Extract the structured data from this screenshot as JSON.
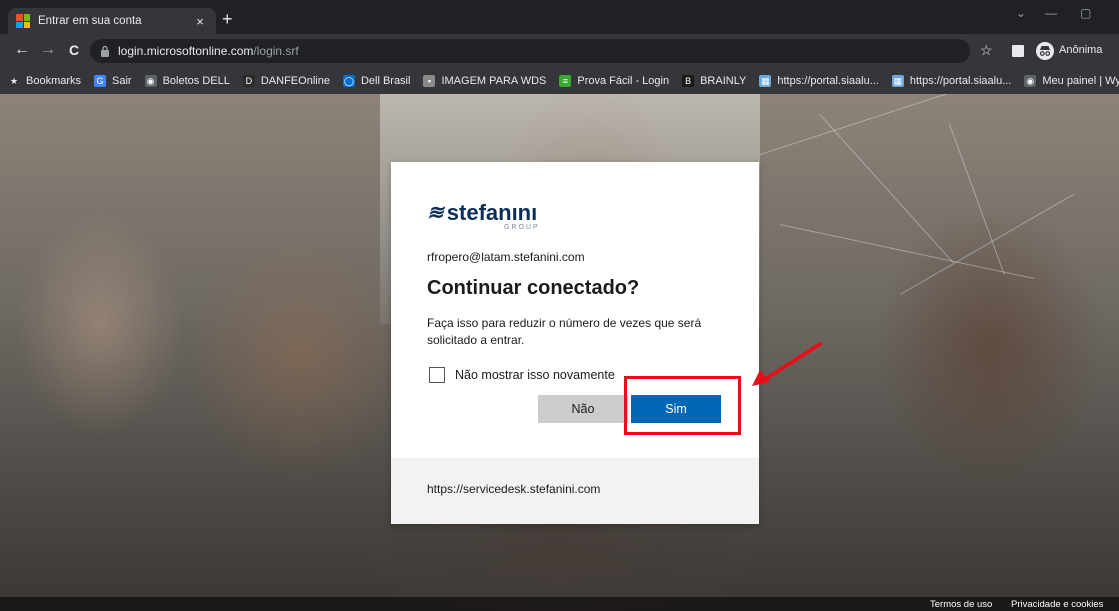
{
  "browser": {
    "tab": {
      "title": "Entrar em sua conta",
      "close_glyph": "×"
    },
    "new_tab_glyph": "+",
    "window_controls": {
      "dropdown_glyph": "⌄",
      "minimize_glyph": "—",
      "restore_glyph": "▢"
    },
    "nav": {
      "back_glyph": "←",
      "forward_glyph": "→",
      "reload_glyph": "C"
    },
    "url": {
      "host": "login.microsoftonline.com",
      "path": "/login.srf"
    },
    "star_glyph": "☆",
    "profile_label": "Anônima",
    "bookmarks": [
      {
        "label": "Bookmarks",
        "icon": "star-icon",
        "glyph": "★",
        "color": "#e8eaed"
      },
      {
        "label": "Sair",
        "icon": "google-icon",
        "glyph": "G",
        "color": "#4285f4"
      },
      {
        "label": "Boletos DELL",
        "icon": "globe-icon",
        "glyph": "◉",
        "color": "#5f6368"
      },
      {
        "label": "DANFEOnline",
        "icon": "d-icon",
        "glyph": "D",
        "color": "#2b2b2b"
      },
      {
        "label": "Dell Brasil",
        "icon": "dell-icon",
        "glyph": "◯",
        "color": "#0672cb"
      },
      {
        "label": "IMAGEM PARA WDS",
        "icon": "image-icon",
        "glyph": "▪",
        "color": "#8a8a8a"
      },
      {
        "label": "Prova Fácil - Login",
        "icon": "list-icon",
        "glyph": "≡",
        "color": "#3aa935"
      },
      {
        "label": "BRAINLY",
        "icon": "brainly-icon",
        "glyph": "B",
        "color": "#1a1a1a"
      },
      {
        "label": "https://portal.siaalu...",
        "icon": "portal-icon",
        "glyph": "▦",
        "color": "#6fa8dc"
      },
      {
        "label": "https://portal.siaalu...",
        "icon": "portal-icon",
        "glyph": "▦",
        "color": "#6fa8dc"
      },
      {
        "label": "Meu painel | Wyde...",
        "icon": "globe-icon",
        "glyph": "◉",
        "color": "#5f6368"
      }
    ]
  },
  "dialog": {
    "logo_mark": "≋",
    "logo_text": "stefanını",
    "logo_group": "GROUP",
    "email": "rfropero@latam.stefanini.com",
    "heading": "Continuar conectado?",
    "description": "Faça isso para reduzir o número de vezes que será solicitado a entrar.",
    "checkbox_label": "Não mostrar isso novamente",
    "checkbox_checked": false,
    "button_no": "Não",
    "button_yes": "Sim",
    "footer_url": "https://servicedesk.stefanini.com"
  },
  "footer": {
    "terms": "Termos de uso",
    "privacy": "Privacidade e cookies"
  },
  "colors": {
    "primary_button": "#0067b8",
    "secondary_button": "#cccccc",
    "annotation_red": "#e5101a",
    "brand_navy": "#0b2e59"
  }
}
